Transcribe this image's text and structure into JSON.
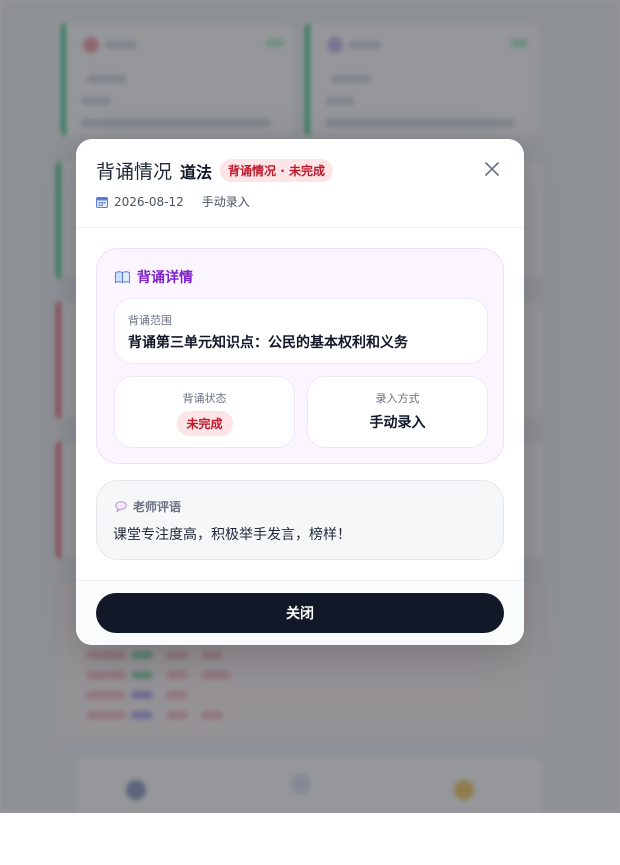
{
  "modal": {
    "title": "背诵情况",
    "subject": "道法",
    "status_pill": "背诵情况 · 未完成",
    "date": "2026-08-12",
    "entry_mode": "手动录入",
    "detail": {
      "section_title": "背诵详情",
      "range_label": "背诵范围",
      "range_value": "背诵第三单元知识点：公民的基本权利和义务",
      "status_label": "背诵状态",
      "status_value": "未完成",
      "method_label": "录入方式",
      "method_value": "手动录入"
    },
    "comment": {
      "title": "老师评语",
      "text": "课堂专注度高，积极举手发言，榜样！"
    },
    "close_label": "关闭"
  },
  "icons": {
    "close": "close-icon",
    "calendar": "calendar-icon",
    "book": "book-icon",
    "comment": "speech-bubble-icon"
  },
  "colors": {
    "accent_purple": "#7e22ce",
    "status_red": "#c0182b",
    "status_red_bg": "#fde4e7",
    "primary_button": "#111827"
  }
}
